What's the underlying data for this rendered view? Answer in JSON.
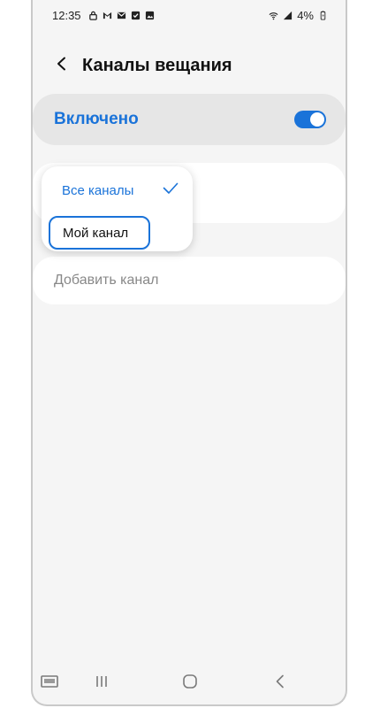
{
  "status_bar": {
    "time": "12:35",
    "battery": "4%",
    "icons": [
      "lock-icon",
      "gmail-icon",
      "mail-icon",
      "checkbox-icon",
      "gallery-icon",
      "wifi-icon",
      "signal-icon",
      "battery-icon"
    ]
  },
  "header": {
    "title": "Каналы вещания",
    "back_icon": "back-arrow-icon"
  },
  "enabled_row": {
    "label": "Включено",
    "toggle_on": true,
    "accent_color": "#1a73d9"
  },
  "dropdown": {
    "items": [
      {
        "label": "Все каналы",
        "selected": true
      },
      {
        "label": "Мой канал",
        "selected": false,
        "highlighted": true
      }
    ],
    "check_icon": "check-icon"
  },
  "add_channel": {
    "label": "Добавить канал"
  },
  "nav_bar": {
    "icons": [
      "keyboard-icon",
      "recent-apps-icon",
      "home-icon",
      "nav-back-icon"
    ]
  }
}
